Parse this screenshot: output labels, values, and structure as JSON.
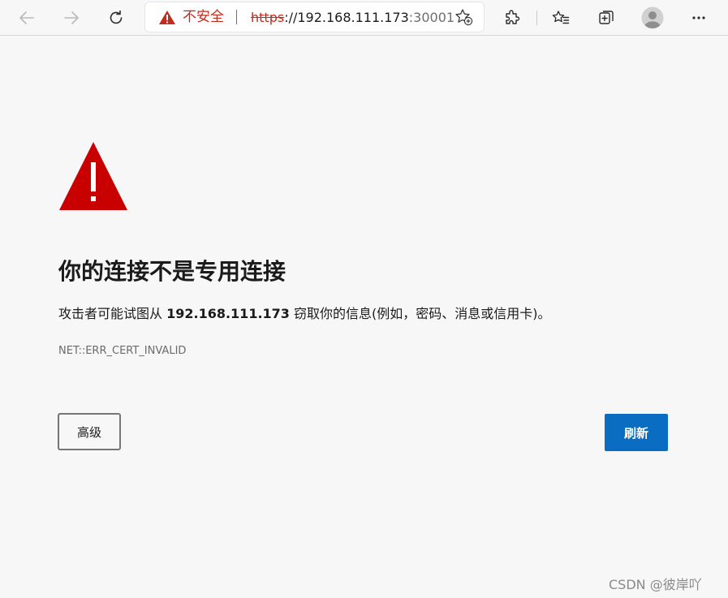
{
  "browser": {
    "security_label": "不安全",
    "url": {
      "scheme": "https",
      "separator": "://",
      "host": "192.168.111.173",
      "port": ":30001"
    },
    "icons": [
      "back-icon",
      "forward-icon",
      "refresh-icon",
      "warning-icon",
      "add-favorite-icon",
      "extensions-icon",
      "favorites-icon",
      "collections-icon",
      "profile-icon",
      "more-icon"
    ]
  },
  "error": {
    "heading": "你的连接不是专用连接",
    "desc_before": "攻击者可能试图从 ",
    "desc_host": "192.168.111.173",
    "desc_after": " 窃取你的信息(例如，密码、消息或信用卡)。",
    "code": "NET::ERR_CERT_INVALID"
  },
  "buttons": {
    "advanced": "高级",
    "refresh": "刷新"
  },
  "watermark": "CSDN @彼岸吖",
  "colors": {
    "danger": "#c42b1c",
    "primary_button": "#0a6dc2",
    "page_background": "#f7f7f7"
  }
}
